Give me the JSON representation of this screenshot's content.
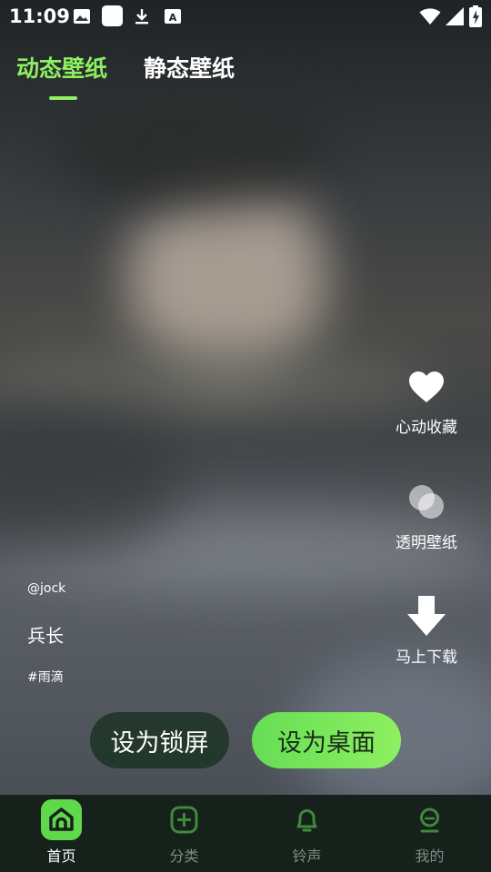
{
  "status_bar": {
    "time": "11:09"
  },
  "tabs": [
    {
      "label": "动态壁纸",
      "active": true
    },
    {
      "label": "静态壁纸",
      "active": false
    }
  ],
  "actions": {
    "favorite": "心动收藏",
    "transparent": "透明壁纸",
    "download": "马上下载"
  },
  "wallpaper": {
    "author": "@jock",
    "title": "兵长",
    "tag": "#雨滴"
  },
  "buttons": {
    "set_lock": "设为锁屏",
    "set_desktop": "设为桌面"
  },
  "nav": [
    {
      "label": "首页",
      "icon": "home-icon",
      "active": true
    },
    {
      "label": "分类",
      "icon": "plus-circle-icon",
      "active": false
    },
    {
      "label": "铃声",
      "icon": "bell-icon",
      "active": false
    },
    {
      "label": "我的",
      "icon": "user-icon",
      "active": false
    }
  ],
  "colors": {
    "accent": "#8ef060",
    "nav_bg": "#17211c"
  }
}
